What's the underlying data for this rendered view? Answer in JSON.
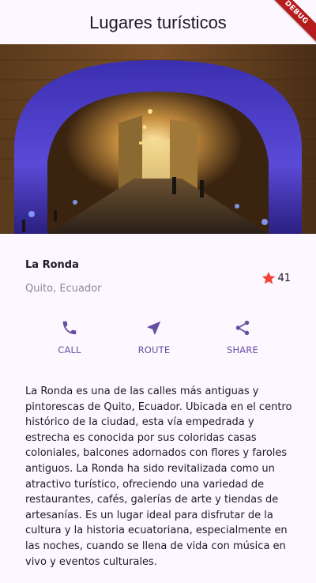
{
  "appbar": {
    "title": "Lugares turísticos",
    "debug_label": "DEBUG"
  },
  "place": {
    "name": "La Ronda",
    "location": "Quito, Ecuador",
    "rating_count": "41",
    "description": "La Ronda es una de las calles más antiguas y pintorescas de Quito, Ecuador. Ubicada en el centro histórico de la ciudad, esta vía empedrada y estrecha es conocida por sus coloridas casas coloniales, balcones adornados con flores y faroles antiguos. La Ronda ha sido revitalizada como un atractivo turístico, ofreciendo una variedad de restaurantes, cafés, galerías de arte y tiendas de artesanías. Es un lugar ideal para disfrutar de la cultura y la historia ecuatoriana, especialmente en las noches, cuando se llena de vida con música en vivo y eventos culturales."
  },
  "actions": {
    "call": {
      "label": "CALL",
      "icon": "phone-icon"
    },
    "route": {
      "label": "ROUTE",
      "icon": "navigation-icon"
    },
    "share": {
      "label": "SHARE",
      "icon": "share-icon"
    }
  },
  "colors": {
    "background": "#fdf7ff",
    "accent": "#6750a4",
    "star": "#f44336",
    "debug_banner": "#b71c1c",
    "secondary_text": "#8d8a92"
  }
}
